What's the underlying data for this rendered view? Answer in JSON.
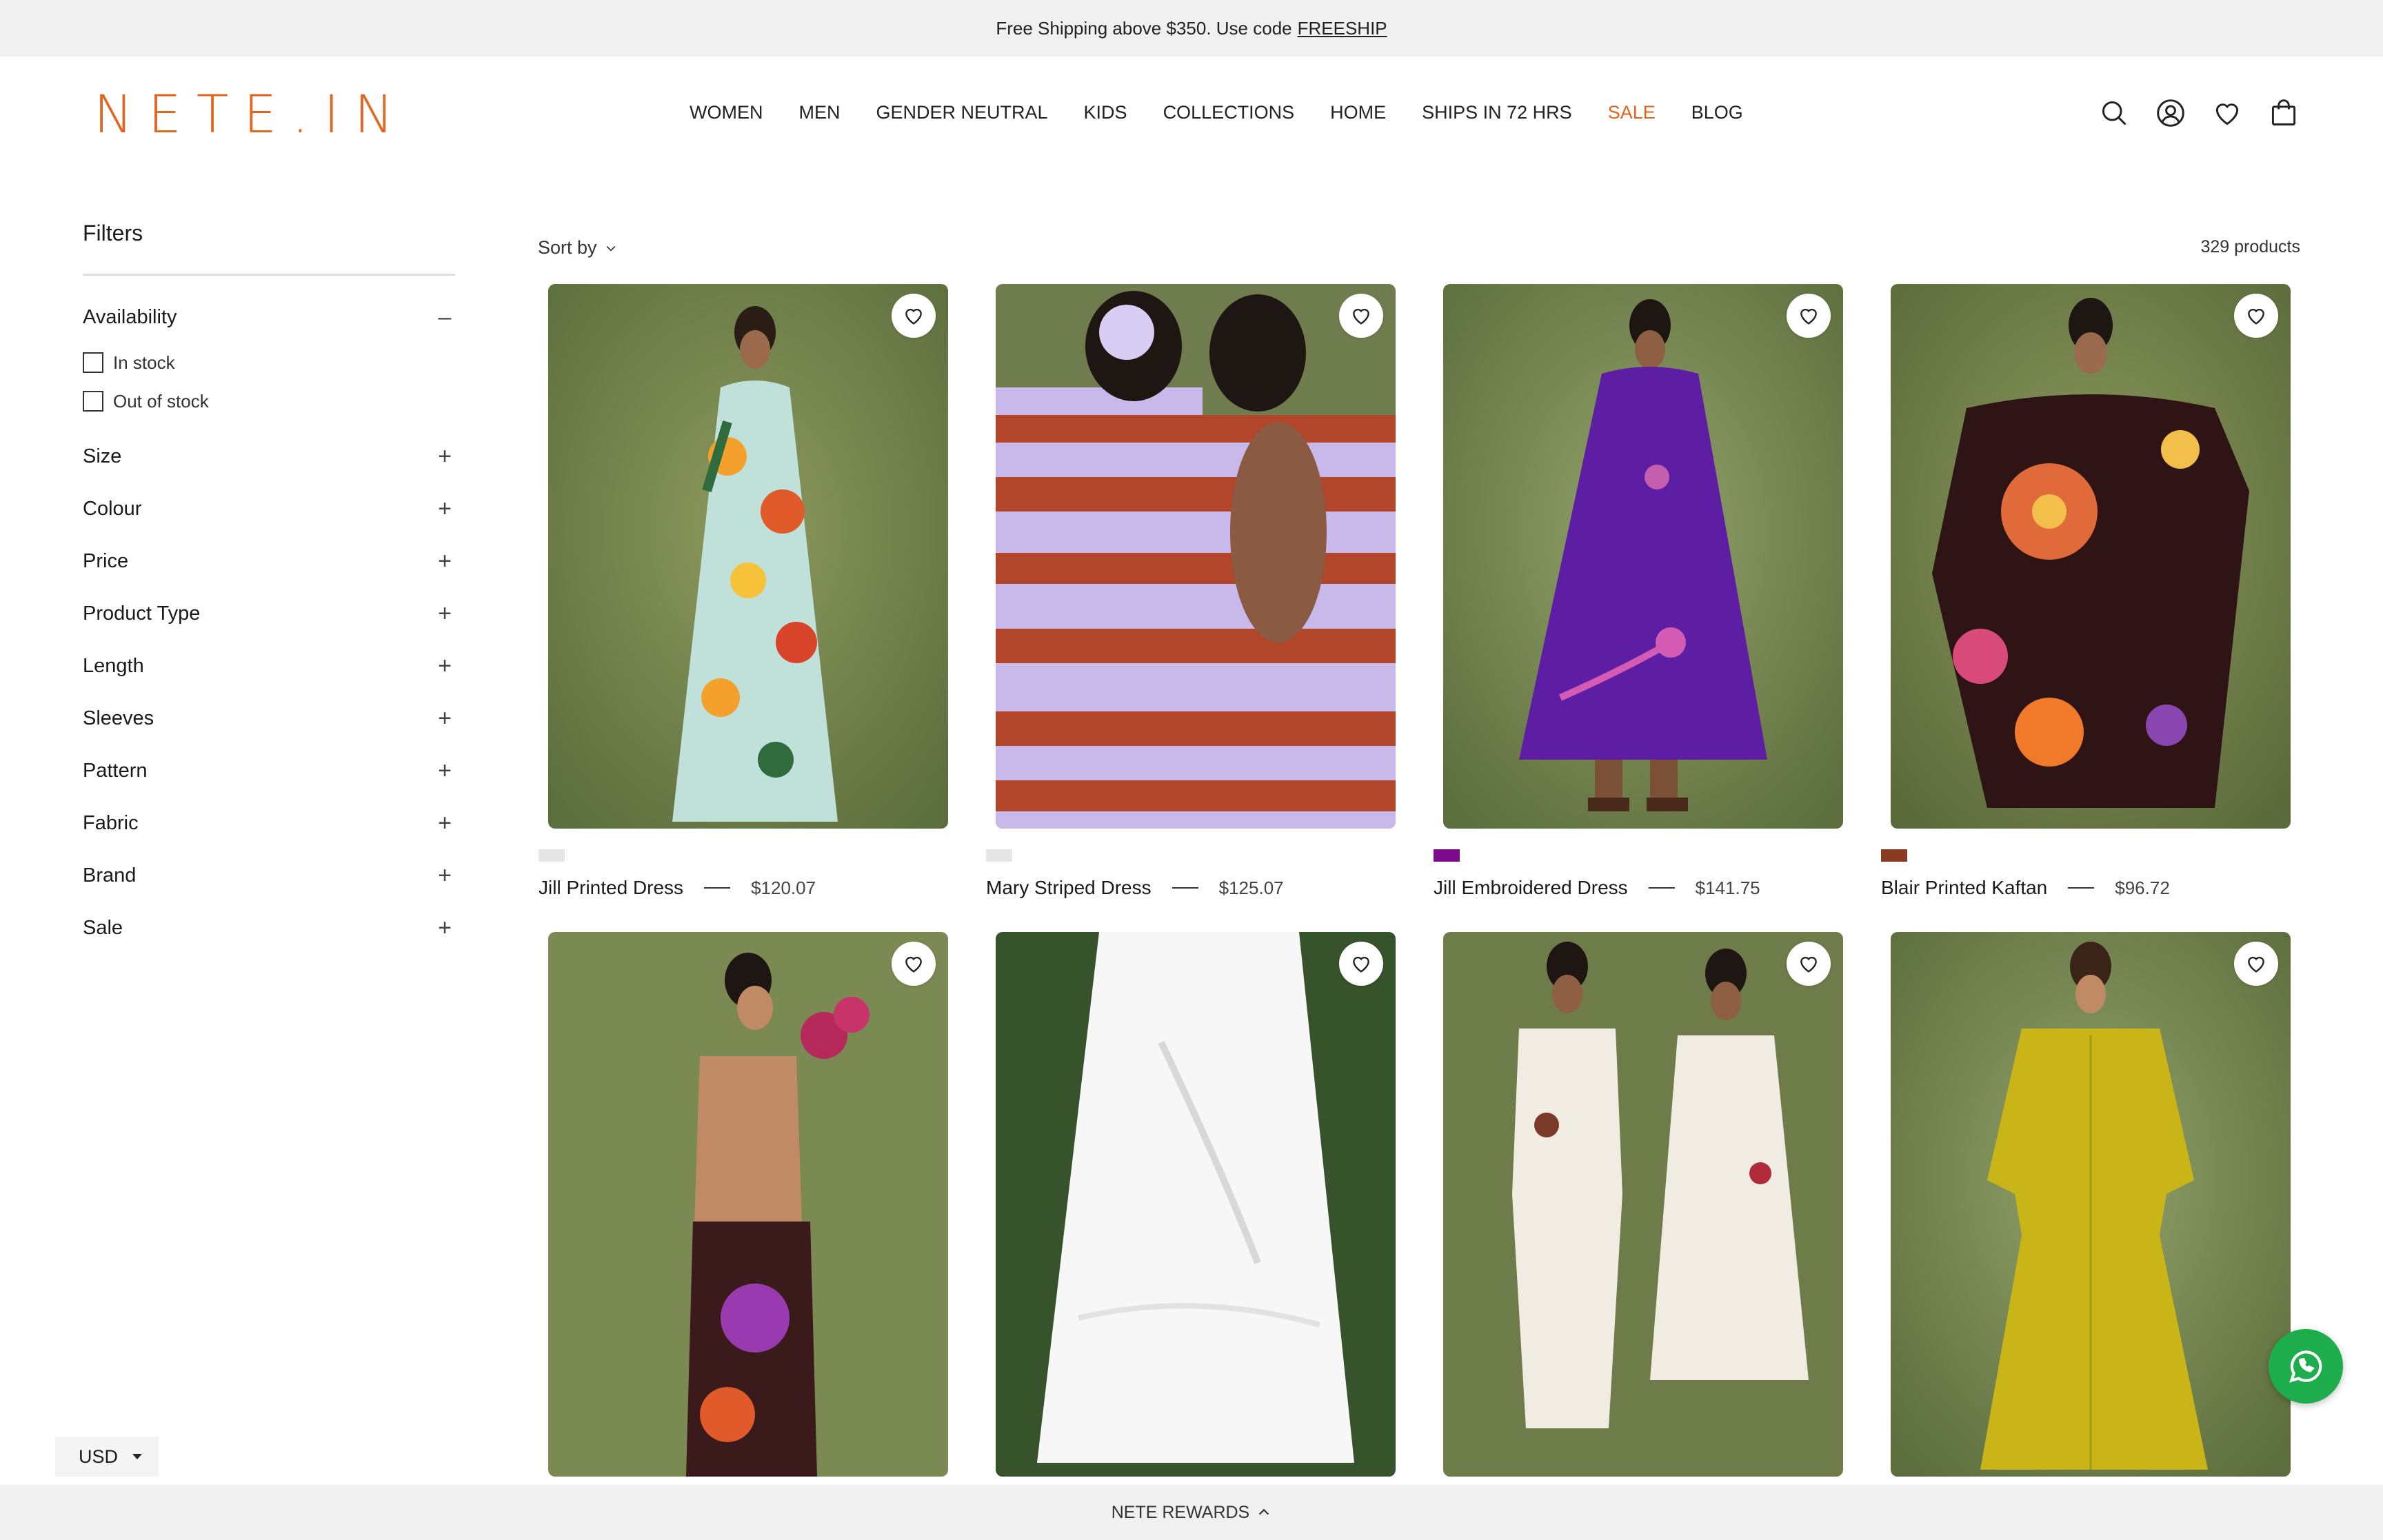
{
  "announcement": {
    "text": "Free Shipping above $350. Use code",
    "code": "FREESHIP"
  },
  "brand": {
    "logo": "NETE.IN",
    "accent": "#e4651d"
  },
  "nav": [
    "WOMEN",
    "MEN",
    "GENDER NEUTRAL",
    "KIDS",
    "COLLECTIONS",
    "HOME",
    "SHIPS IN 72 HRS",
    "SALE",
    "BLOG"
  ],
  "header_icons": [
    "search-icon",
    "account-icon",
    "heart-icon",
    "bag-icon"
  ],
  "filters": {
    "title": "Filters",
    "availability": {
      "label": "Availability",
      "sign": "–",
      "options": [
        "In stock",
        "Out of stock"
      ]
    },
    "groups": [
      "Size",
      "Colour",
      "Price",
      "Product Type",
      "Length",
      "Sleeves",
      "Pattern",
      "Fabric",
      "Brand",
      "Sale"
    ],
    "expand_sign": "+"
  },
  "toolbar": {
    "sort_label": "Sort by",
    "count": "329 products"
  },
  "products": [
    {
      "name": "Jill Printed Dress",
      "price": "$120.07",
      "swatch": "#e6e6e6"
    },
    {
      "name": "Mary Striped Dress",
      "price": "$125.07",
      "swatch": "#e6e6e6"
    },
    {
      "name": "Jill Embroidered Dress",
      "price": "$141.75",
      "swatch": "#7d0a8c"
    },
    {
      "name": "Blair Printed Kaftan",
      "price": "$96.72",
      "swatch": "#8b3a22"
    },
    {
      "name": "",
      "price": "",
      "swatch": ""
    },
    {
      "name": "",
      "price": "",
      "swatch": ""
    },
    {
      "name": "",
      "price": "",
      "swatch": ""
    },
    {
      "name": "",
      "price": "",
      "swatch": ""
    }
  ],
  "footer": {
    "currency": "USD",
    "rewards": "NETE REWARDS"
  }
}
